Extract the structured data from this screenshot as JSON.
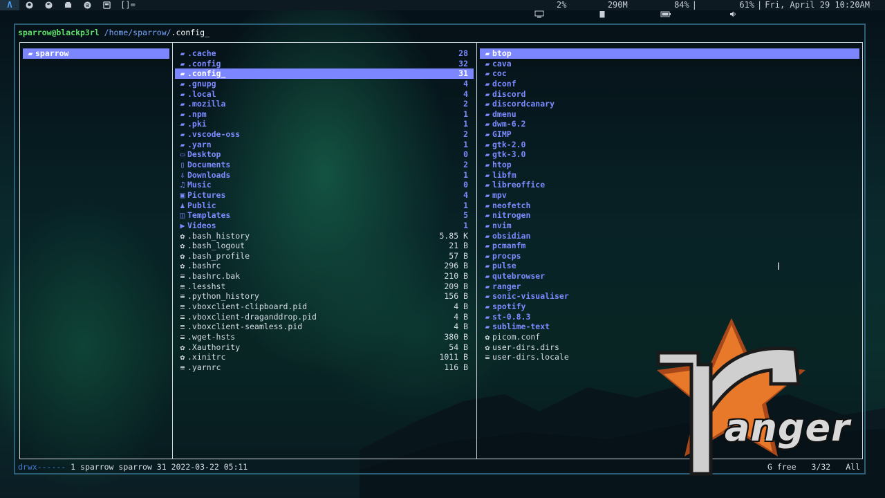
{
  "topbar": {
    "workspaces": [
      "Λ",
      "",
      "",
      "",
      "",
      "",
      "[]="
    ],
    "cpu": "2%",
    "mem": "290M",
    "battery": "84%",
    "volume": "61%",
    "datetime": "Fri, April 29 10:20AM"
  },
  "prompt": {
    "user_host": "sparrow@blackp3rl",
    "path_prefix": "/home/sparrow/",
    "path_current": ".config_"
  },
  "pane1": [
    {
      "name": "sparrow",
      "type": "dir",
      "selected": true
    }
  ],
  "pane2": [
    {
      "name": ".cache",
      "size": "28",
      "type": "dir",
      "icon": "folder"
    },
    {
      "name": ".config",
      "size": "32",
      "type": "dir",
      "icon": "folder"
    },
    {
      "name": ".config_",
      "size": "31",
      "type": "dir",
      "icon": "folder",
      "selected": true
    },
    {
      "name": ".gnupg",
      "size": "4",
      "type": "dir",
      "icon": "folder"
    },
    {
      "name": ".local",
      "size": "4",
      "type": "dir",
      "icon": "folder"
    },
    {
      "name": ".mozilla",
      "size": "2",
      "type": "dir",
      "icon": "folder"
    },
    {
      "name": ".npm",
      "size": "1",
      "type": "dir",
      "icon": "folder"
    },
    {
      "name": ".pki",
      "size": "1",
      "type": "dir",
      "icon": "folder"
    },
    {
      "name": ".vscode-oss",
      "size": "2",
      "type": "dir",
      "icon": "folder"
    },
    {
      "name": ".yarn",
      "size": "1",
      "type": "dir",
      "icon": "folder"
    },
    {
      "name": "Desktop",
      "size": "0",
      "type": "dir",
      "icon": "desktop"
    },
    {
      "name": "Documents",
      "size": "2",
      "type": "dir",
      "icon": "document"
    },
    {
      "name": "Downloads",
      "size": "1",
      "type": "dir",
      "icon": "download"
    },
    {
      "name": "Music",
      "size": "0",
      "type": "dir",
      "icon": "music"
    },
    {
      "name": "Pictures",
      "size": "4",
      "type": "dir",
      "icon": "picture"
    },
    {
      "name": "Public",
      "size": "1",
      "type": "dir",
      "icon": "users"
    },
    {
      "name": "Templates",
      "size": "5",
      "type": "dir",
      "icon": "template"
    },
    {
      "name": "Videos",
      "size": "1",
      "type": "dir",
      "icon": "video"
    },
    {
      "name": ".bash_history",
      "size": "5.85 K",
      "type": "file",
      "icon": "gear"
    },
    {
      "name": ".bash_logout",
      "size": "21 B",
      "type": "file",
      "icon": "gear"
    },
    {
      "name": ".bash_profile",
      "size": "57 B",
      "type": "file",
      "icon": "gear"
    },
    {
      "name": ".bashrc",
      "size": "296 B",
      "type": "file",
      "icon": "gear"
    },
    {
      "name": ".bashrc.bak",
      "size": "210 B",
      "type": "file",
      "icon": "lines"
    },
    {
      "name": ".lesshst",
      "size": "209 B",
      "type": "file",
      "icon": "lines"
    },
    {
      "name": ".python_history",
      "size": "156 B",
      "type": "file",
      "icon": "lines"
    },
    {
      "name": ".vboxclient-clipboard.pid",
      "size": "4 B",
      "type": "file",
      "icon": "lines"
    },
    {
      "name": ".vboxclient-draganddrop.pid",
      "size": "4 B",
      "type": "file",
      "icon": "lines"
    },
    {
      "name": ".vboxclient-seamless.pid",
      "size": "4 B",
      "type": "file",
      "icon": "lines"
    },
    {
      "name": ".wget-hsts",
      "size": "380 B",
      "type": "file",
      "icon": "lines"
    },
    {
      "name": ".Xauthority",
      "size": "54 B",
      "type": "file",
      "icon": "gear"
    },
    {
      "name": ".xinitrc",
      "size": "1011 B",
      "type": "file",
      "icon": "gear"
    },
    {
      "name": ".yarnrc",
      "size": "116 B",
      "type": "file",
      "icon": "lines"
    }
  ],
  "pane3": [
    {
      "name": "btop",
      "type": "dir",
      "icon": "folder",
      "selected": true
    },
    {
      "name": "cava",
      "type": "dir",
      "icon": "folder"
    },
    {
      "name": "coc",
      "type": "dir",
      "icon": "folder"
    },
    {
      "name": "dconf",
      "type": "dir",
      "icon": "folder"
    },
    {
      "name": "discord",
      "type": "dir",
      "icon": "folder"
    },
    {
      "name": "discordcanary",
      "type": "dir",
      "icon": "folder"
    },
    {
      "name": "dmenu",
      "type": "dir",
      "icon": "folder"
    },
    {
      "name": "dwm-6.2",
      "type": "dir",
      "icon": "folder"
    },
    {
      "name": "GIMP",
      "type": "dir",
      "icon": "folder"
    },
    {
      "name": "gtk-2.0",
      "type": "dir",
      "icon": "folder"
    },
    {
      "name": "gtk-3.0",
      "type": "dir",
      "icon": "folder"
    },
    {
      "name": "htop",
      "type": "dir",
      "icon": "folder"
    },
    {
      "name": "libfm",
      "type": "dir",
      "icon": "folder"
    },
    {
      "name": "libreoffice",
      "type": "dir",
      "icon": "folder"
    },
    {
      "name": "mpv",
      "type": "dir",
      "icon": "folder"
    },
    {
      "name": "neofetch",
      "type": "dir",
      "icon": "folder"
    },
    {
      "name": "nitrogen",
      "type": "dir",
      "icon": "folder"
    },
    {
      "name": "nvim",
      "type": "dir",
      "icon": "folder"
    },
    {
      "name": "obsidian",
      "type": "dir",
      "icon": "folder"
    },
    {
      "name": "pcmanfm",
      "type": "dir",
      "icon": "folder"
    },
    {
      "name": "procps",
      "type": "dir",
      "icon": "folder"
    },
    {
      "name": "pulse",
      "type": "dir",
      "icon": "folder"
    },
    {
      "name": "qutebrowser",
      "type": "dir",
      "icon": "folder"
    },
    {
      "name": "ranger",
      "type": "dir",
      "icon": "folder"
    },
    {
      "name": "sonic-visualiser",
      "type": "dir",
      "icon": "folder"
    },
    {
      "name": "spotify",
      "type": "dir",
      "icon": "folder"
    },
    {
      "name": "st-0.8.3",
      "type": "dir",
      "icon": "folder"
    },
    {
      "name": "sublime-text",
      "type": "dir",
      "icon": "folder"
    },
    {
      "name": "picom.conf",
      "type": "file",
      "icon": "gear"
    },
    {
      "name": "user-dirs.dirs",
      "type": "file",
      "icon": "gear"
    },
    {
      "name": "user-dirs.locale",
      "type": "file",
      "icon": "lines"
    }
  ],
  "statusbar": {
    "permissions": "drwx------",
    "info": " 1 sparrow sparrow 31 2022-03-22 05:11",
    "free": "G free",
    "position": "3/32",
    "scroll": "All"
  },
  "logo": {
    "text": "anger",
    "colors": {
      "star": "#e8782a",
      "star_dark": "#a8481a",
      "letter": "#cfcfcf"
    }
  },
  "colors": {
    "directory": "#7c8bff",
    "selection": "#7b86ff",
    "prompt_user": "#5fe06a",
    "border": "#2d5f78"
  }
}
